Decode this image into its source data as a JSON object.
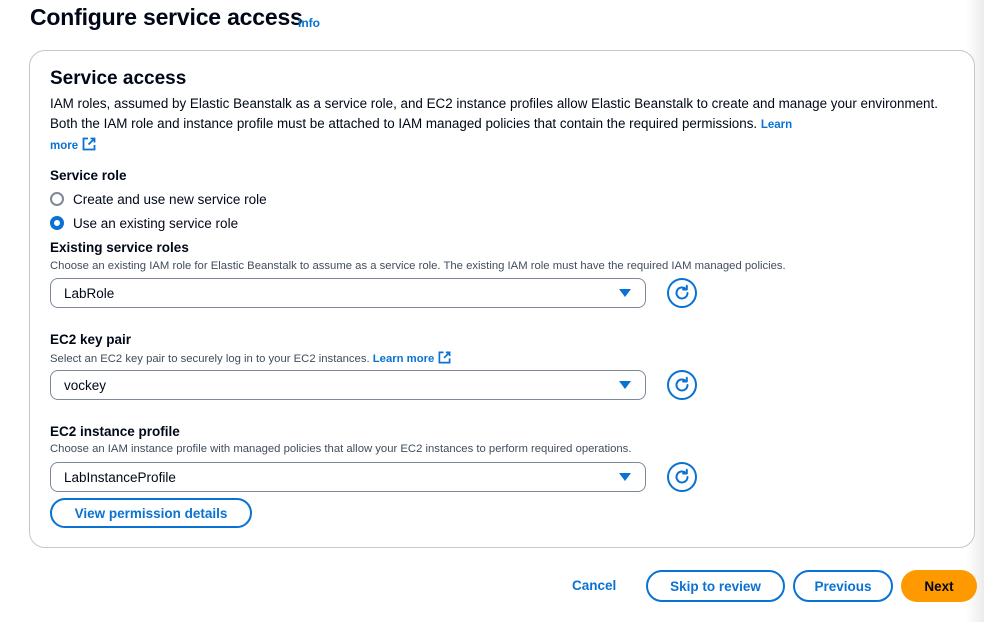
{
  "page": {
    "title": "Configure service access",
    "info_link": "Info"
  },
  "service_access": {
    "title": "Service access",
    "description": "IAM roles, assumed by Elastic Beanstalk as a service role, and EC2 instance profiles allow Elastic Beanstalk to create and manage your environment. Both the IAM role and instance profile must be attached to IAM managed policies that contain the required permissions.",
    "learn_more_1": "Learn",
    "learn_more_2": "more"
  },
  "service_role": {
    "label": "Service role",
    "options": [
      {
        "label": "Create and use new service role",
        "selected": false
      },
      {
        "label": "Use an existing service role",
        "selected": true
      }
    ]
  },
  "existing_roles": {
    "label": "Existing service roles",
    "description": "Choose an existing IAM role for Elastic Beanstalk to assume as a service role. The existing IAM role must have the required IAM managed policies.",
    "value": "LabRole"
  },
  "key_pair": {
    "label": "EC2 key pair",
    "description": "Select an EC2 key pair to securely log in to your EC2 instances.",
    "learn_more": "Learn more",
    "value": "vockey"
  },
  "instance_profile": {
    "label": "EC2 instance profile",
    "description": "Choose an IAM instance profile with managed policies that allow your EC2 instances to perform required operations.",
    "value": "LabInstanceProfile"
  },
  "buttons": {
    "view_permissions": "View permission details",
    "cancel": "Cancel",
    "skip": "Skip to review",
    "previous": "Previous",
    "next": "Next"
  },
  "icons": {
    "external_link": "external-link-icon",
    "refresh": "refresh-icon",
    "caret": "caret-down-icon"
  },
  "colors": {
    "link": "#0972d3",
    "primary_button": "#ff9900",
    "text": "#000716",
    "border": "#7d8998"
  }
}
